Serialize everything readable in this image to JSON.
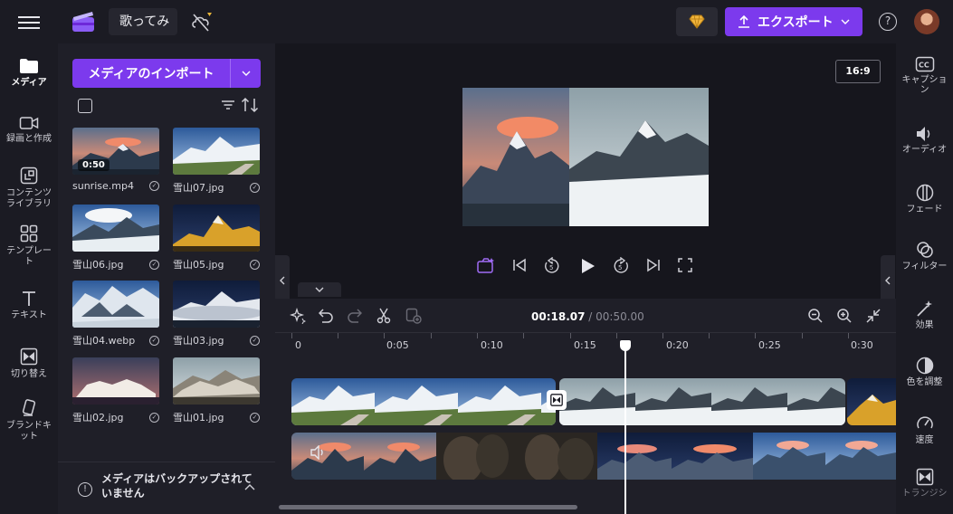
{
  "header": {
    "project_title": "歌ってみ",
    "export_label": "エクスポート"
  },
  "left_rail": {
    "items": [
      {
        "label": "メディア",
        "icon": "folder-icon"
      },
      {
        "label": "録画と作成",
        "icon": "camera-icon"
      },
      {
        "label": "コンテンツライブラリ",
        "icon": "library-icon"
      },
      {
        "label": "テンプレート",
        "icon": "template-icon"
      },
      {
        "label": "テキスト",
        "icon": "text-icon"
      },
      {
        "label": "切り替え",
        "icon": "transition-icon"
      },
      {
        "label": "ブランドキット",
        "icon": "brand-kit-icon"
      }
    ]
  },
  "media_panel": {
    "import_label": "メディアのインポート",
    "items": [
      {
        "name": "sunrise.mp4",
        "duration": "0:50"
      },
      {
        "name": "雪山07.jpg"
      },
      {
        "name": "雪山06.jpg"
      },
      {
        "name": "雪山05.jpg"
      },
      {
        "name": "雪山04.webp"
      },
      {
        "name": "雪山03.jpg"
      },
      {
        "name": "雪山02.jpg"
      },
      {
        "name": "雪山01.jpg"
      }
    ],
    "backup_notice": "メディアはバックアップされていません"
  },
  "preview": {
    "aspect_ratio": "16:9"
  },
  "timeline": {
    "current_time": "00:18.07",
    "total_time": "/ 00:50.00",
    "ruler_labels": [
      "0",
      "0:05",
      "0:10",
      "0:15",
      "0:20",
      "0:25",
      "0:30"
    ]
  },
  "right_rail": {
    "items": [
      {
        "label": "キャプション",
        "icon": "captions-icon"
      },
      {
        "label": "オーディオ",
        "icon": "audio-icon"
      },
      {
        "label": "フェード",
        "icon": "fade-icon"
      },
      {
        "label": "フィルター",
        "icon": "filter-icon"
      },
      {
        "label": "効果",
        "icon": "effects-icon"
      },
      {
        "label": "色を調整",
        "icon": "color-adjust-icon"
      },
      {
        "label": "速度",
        "icon": "speed-icon"
      },
      {
        "label": "トランジシ",
        "icon": "transition-icon"
      }
    ]
  },
  "colors": {
    "accent": "#7c3aed",
    "background": "#16161d",
    "panel": "#1f1f28"
  }
}
